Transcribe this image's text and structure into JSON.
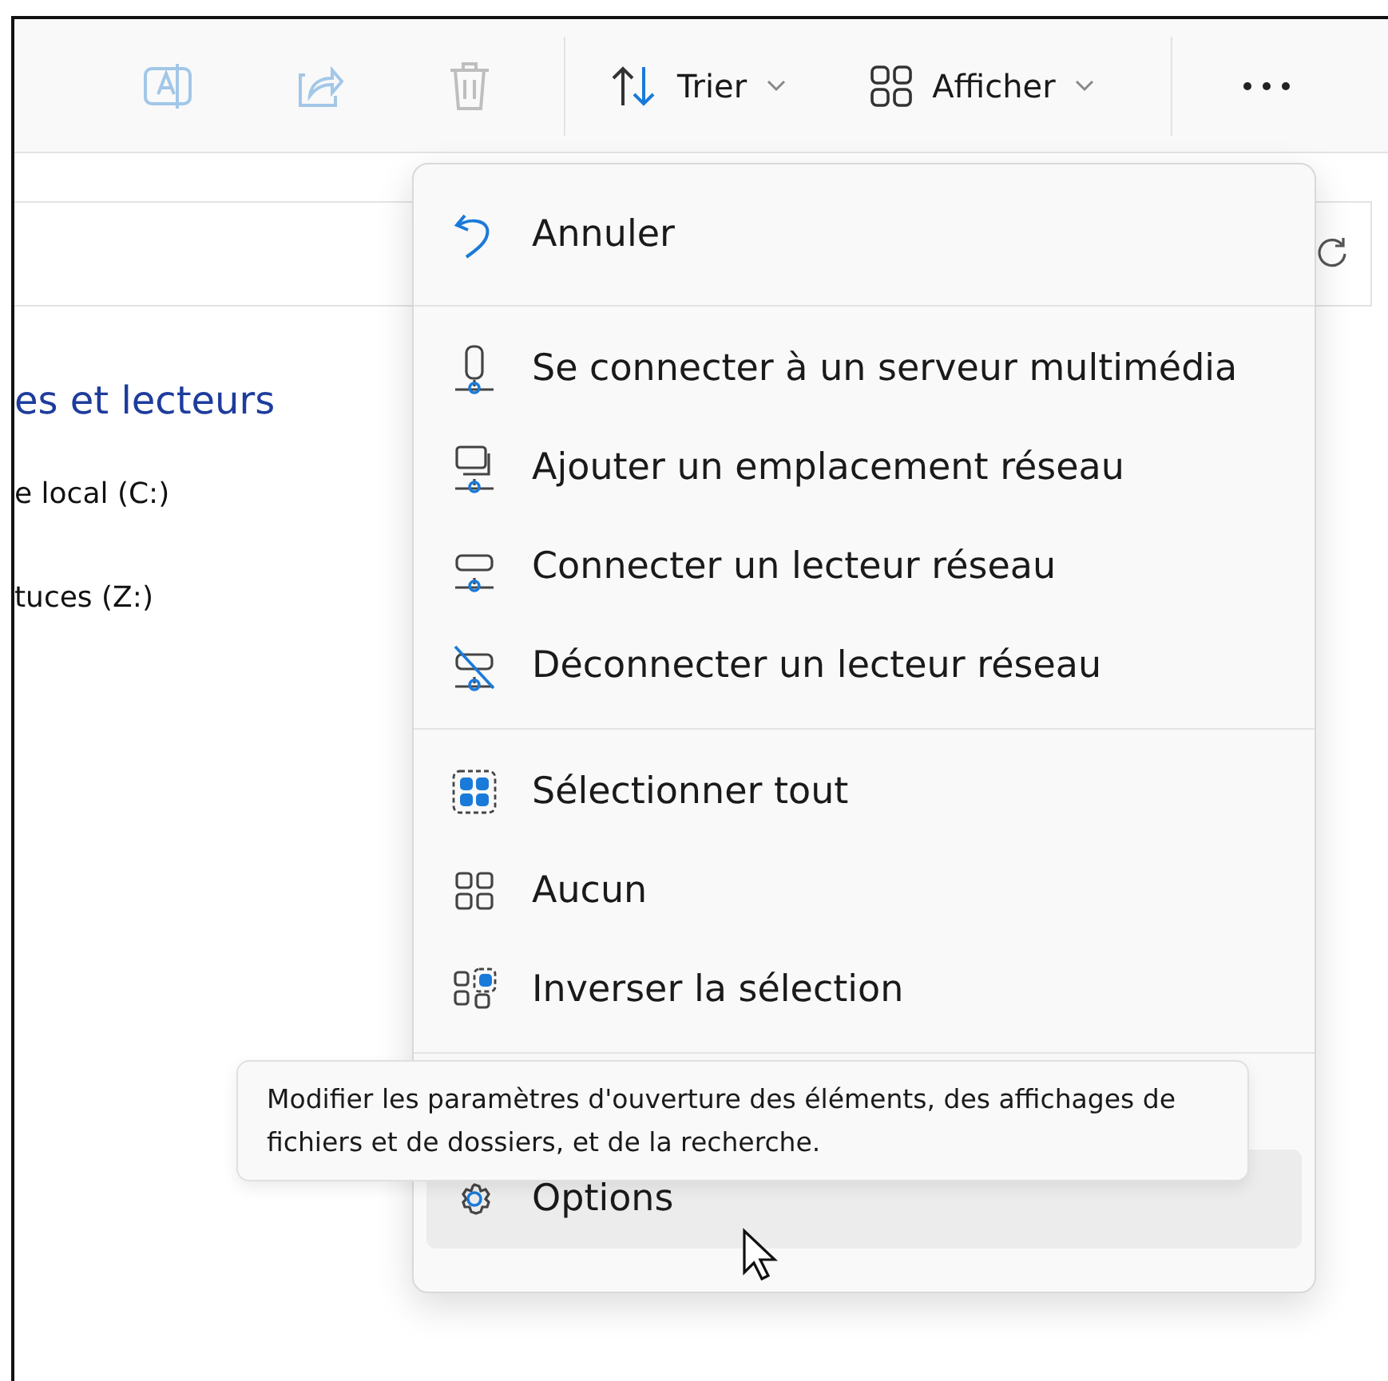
{
  "toolbar": {
    "actions": [
      {
        "kind": "rename",
        "disabled": true
      },
      {
        "kind": "share",
        "disabled": true
      },
      {
        "kind": "delete",
        "disabled": true
      }
    ],
    "dropdowns": [
      {
        "kind": "sort",
        "label": "Trier"
      },
      {
        "kind": "view",
        "label": "Afficher"
      }
    ]
  },
  "content": {
    "heading": "es et lecteurs",
    "drives": [
      "e local (C:)",
      "tuces (Z:)"
    ]
  },
  "menu": {
    "sections": [
      {
        "items": [
          {
            "kind": "undo",
            "label": "Annuler",
            "selected": false
          }
        ]
      },
      {
        "items": [
          {
            "kind": "media",
            "label": "Se connecter à un serveur multimédia",
            "selected": false
          },
          {
            "kind": "addloc",
            "label": "Ajouter un emplacement réseau",
            "selected": false
          },
          {
            "kind": "mapdrive",
            "label": "Connecter un lecteur réseau",
            "selected": false
          },
          {
            "kind": "unmap",
            "label": "Déconnecter un lecteur réseau",
            "selected": false
          }
        ]
      },
      {
        "items": [
          {
            "kind": "selectall",
            "label": "Sélectionner tout",
            "selected": false
          },
          {
            "kind": "none",
            "label": "Aucun",
            "selected": false
          },
          {
            "kind": "invert",
            "label": "Inverser la sélection",
            "selected": false
          }
        ]
      },
      {
        "items": [
          {
            "kind": "options",
            "label": "Options",
            "selected": true
          }
        ]
      }
    ]
  },
  "tooltip": {
    "text": "Modifier les paramètres d'ouverture des éléments, des affichages de fichiers et de dossiers, et de la recherche."
  }
}
